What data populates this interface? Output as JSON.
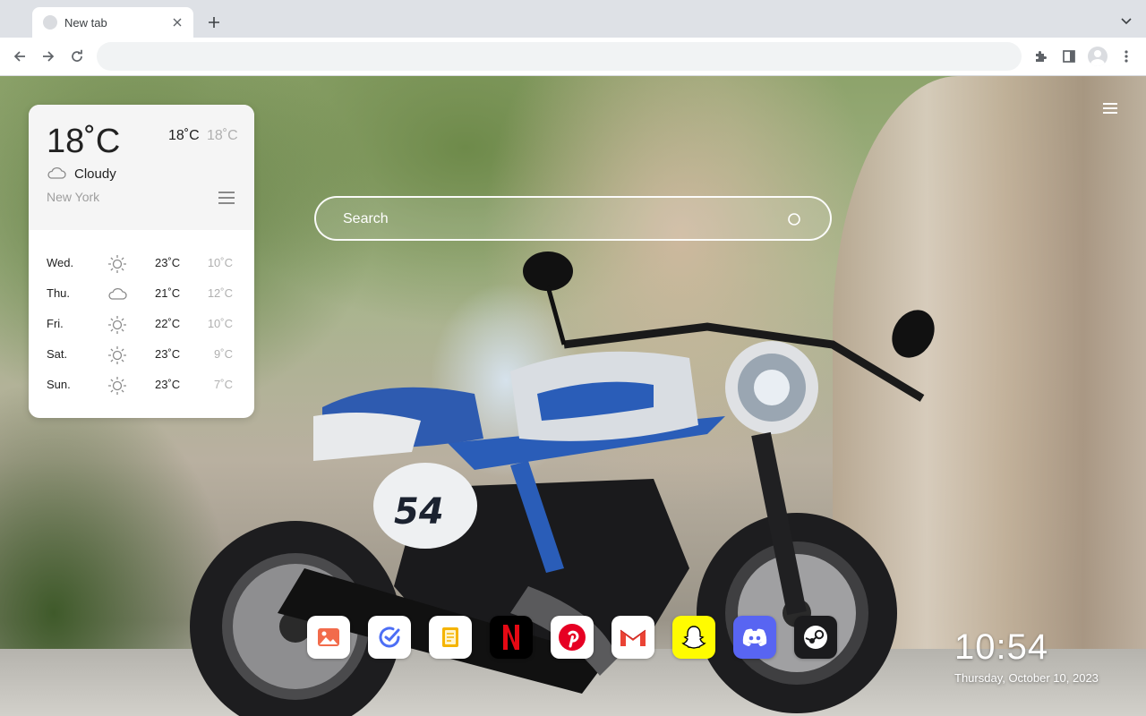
{
  "browser": {
    "tab_title": "New tab",
    "omnibox_value": ""
  },
  "weather": {
    "current_temp": "18˚C",
    "today_high": "18˚C",
    "today_low": "18˚C",
    "condition": "Cloudy",
    "city": "New York",
    "forecast": [
      {
        "day": "Wed.",
        "icon": "sun-icon",
        "high": "23˚C",
        "low": "10˚C"
      },
      {
        "day": "Thu.",
        "icon": "cloud-icon",
        "high": "21˚C",
        "low": "12˚C"
      },
      {
        "day": "Fri.",
        "icon": "sun-icon",
        "high": "22˚C",
        "low": "10˚C"
      },
      {
        "day": "Sat.",
        "icon": "sun-icon",
        "high": "23˚C",
        "low": "9˚C"
      },
      {
        "day": "Sun.",
        "icon": "sun-icon",
        "high": "23˚C",
        "low": "7˚C"
      }
    ]
  },
  "search": {
    "placeholder": "Search"
  },
  "dock": {
    "items": [
      {
        "name": "gallery",
        "icon": "image-icon",
        "color": "#f26b4b"
      },
      {
        "name": "todo",
        "icon": "check-icon",
        "color": "#4c6ef5"
      },
      {
        "name": "notes",
        "icon": "note-icon",
        "color": "#f5b400"
      },
      {
        "name": "netflix",
        "icon": "netflix-icon",
        "color": "#e50914"
      },
      {
        "name": "pinterest",
        "icon": "pinterest-icon",
        "color": "#e60023"
      },
      {
        "name": "gmail",
        "icon": "gmail-icon",
        "color": "#ea4335"
      },
      {
        "name": "snapchat",
        "icon": "snapchat-icon",
        "color": "#fffc00"
      },
      {
        "name": "discord",
        "icon": "discord-icon",
        "color": "#5865f2"
      },
      {
        "name": "steam",
        "icon": "steam-icon",
        "color": "#1b2838"
      }
    ]
  },
  "clock": {
    "time": "10:54",
    "date": "Thursday, October 10, 2023"
  }
}
